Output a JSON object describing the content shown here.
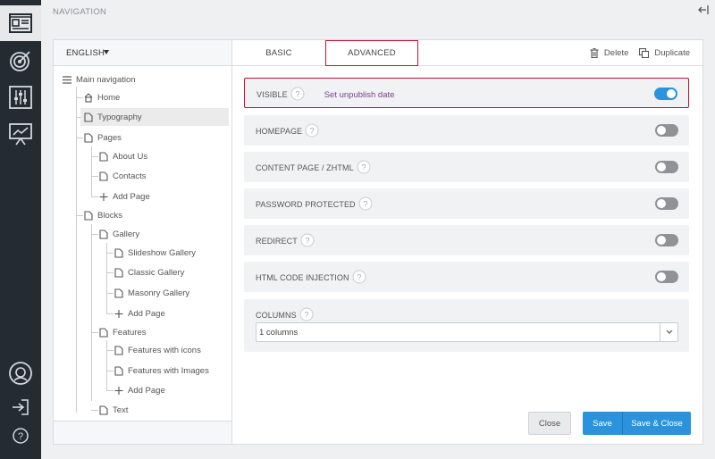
{
  "app": {
    "title": "NAVIGATION"
  },
  "language": {
    "selected": "ENGLISH"
  },
  "tree": {
    "root": "Main navigation",
    "items": [
      {
        "label": "Home",
        "icon": "home-icon"
      },
      {
        "label": "Typography",
        "icon": "page-icon"
      },
      {
        "label": "Pages",
        "icon": "page-icon"
      },
      {
        "label": "About Us",
        "icon": "page-icon"
      },
      {
        "label": "Contacts",
        "icon": "page-icon"
      },
      {
        "label": "Add Page",
        "icon": "plus-icon"
      },
      {
        "label": "Blocks",
        "icon": "page-icon"
      },
      {
        "label": "Gallery",
        "icon": "page-icon"
      },
      {
        "label": "Slideshow Gallery",
        "icon": "page-icon"
      },
      {
        "label": "Classic Gallery",
        "icon": "page-icon"
      },
      {
        "label": "Masonry Gallery",
        "icon": "page-icon"
      },
      {
        "label": "Add Page",
        "icon": "plus-icon"
      },
      {
        "label": "Features",
        "icon": "page-icon"
      },
      {
        "label": "Features with icons",
        "icon": "page-icon"
      },
      {
        "label": "Features with Images",
        "icon": "page-icon"
      },
      {
        "label": "Add Page",
        "icon": "plus-icon"
      },
      {
        "label": "Text",
        "icon": "page-icon"
      }
    ]
  },
  "tabs": {
    "basic": "BASIC",
    "advanced": "ADVANCED"
  },
  "actions": {
    "delete": "Delete",
    "duplicate": "Duplicate"
  },
  "settings": {
    "visible": {
      "label": "VISIBLE",
      "link": "Set unpublish date",
      "on": true
    },
    "homepage": {
      "label": "HOMEPAGE",
      "on": false
    },
    "content_page": {
      "label": "CONTENT PAGE / ZHTML",
      "on": false
    },
    "password": {
      "label": "PASSWORD PROTECTED",
      "on": false
    },
    "redirect": {
      "label": "REDIRECT",
      "on": false
    },
    "html_injection": {
      "label": "HTML CODE INJECTION",
      "on": false
    },
    "columns": {
      "label": "COLUMNS",
      "value": "1 columns"
    }
  },
  "buttons": {
    "close": "Close",
    "save": "Save",
    "save_close": "Save & Close"
  },
  "colors": {
    "accent": "#2a93dc",
    "highlight": "#c8102e",
    "rail": "#252b33",
    "link": "#7a3e8a"
  }
}
